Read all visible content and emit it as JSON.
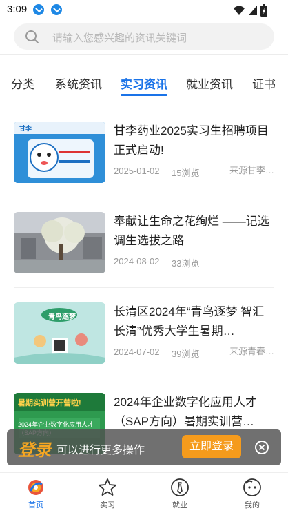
{
  "status_bar": {
    "time": "3:09",
    "icons": [
      "download-icon",
      "download-icon",
      "wifi-icon",
      "signal-icon",
      "battery-icon"
    ]
  },
  "search": {
    "placeholder": "请输入您感兴趣的资讯关键词"
  },
  "tabs": [
    {
      "label": "分类",
      "active": false
    },
    {
      "label": "系统资讯",
      "active": false
    },
    {
      "label": "实习资讯",
      "active": true
    },
    {
      "label": "就业资讯",
      "active": false
    },
    {
      "label": "证书",
      "active": false
    }
  ],
  "news": [
    {
      "title": "甘李药业2025实习生招聘项目正式启动!",
      "date": "2025-01-02",
      "views": "15浏览",
      "source": "来源甘李…",
      "thumb_text": "甘李"
    },
    {
      "title": "奉献让生命之花绚烂 ——记选调生选拔之路",
      "date": "2024-08-02",
      "views": "33浏览",
      "source": ""
    },
    {
      "title": "长清区2024年“青鸟逐梦 智汇长清”优秀大学生暑期…",
      "date": "2024-07-02",
      "views": "39浏览",
      "source": "来源青春…",
      "thumb_text": "青鸟逐梦"
    },
    {
      "title": "2024年企业数字化应用人才（SAP方向）暑期实训营…",
      "date": "",
      "views": "",
      "source": "",
      "thumb_text": "暑期实训营开营啦!",
      "thumb_sub": "2024年企业数字化应用人才（SAP方向）"
    }
  ],
  "login_banner": {
    "big_text": "登录",
    "text": "可以进行更多操作",
    "button": "立即登录"
  },
  "bottom_nav": [
    {
      "label": "首页",
      "icon": "home-icon",
      "active": true
    },
    {
      "label": "实习",
      "icon": "star-icon",
      "active": false
    },
    {
      "label": "就业",
      "icon": "tie-icon",
      "active": false
    },
    {
      "label": "我的",
      "icon": "profile-icon",
      "active": false
    }
  ],
  "colors": {
    "accent": "#1a73e8",
    "login_button": "#f59b1c"
  }
}
